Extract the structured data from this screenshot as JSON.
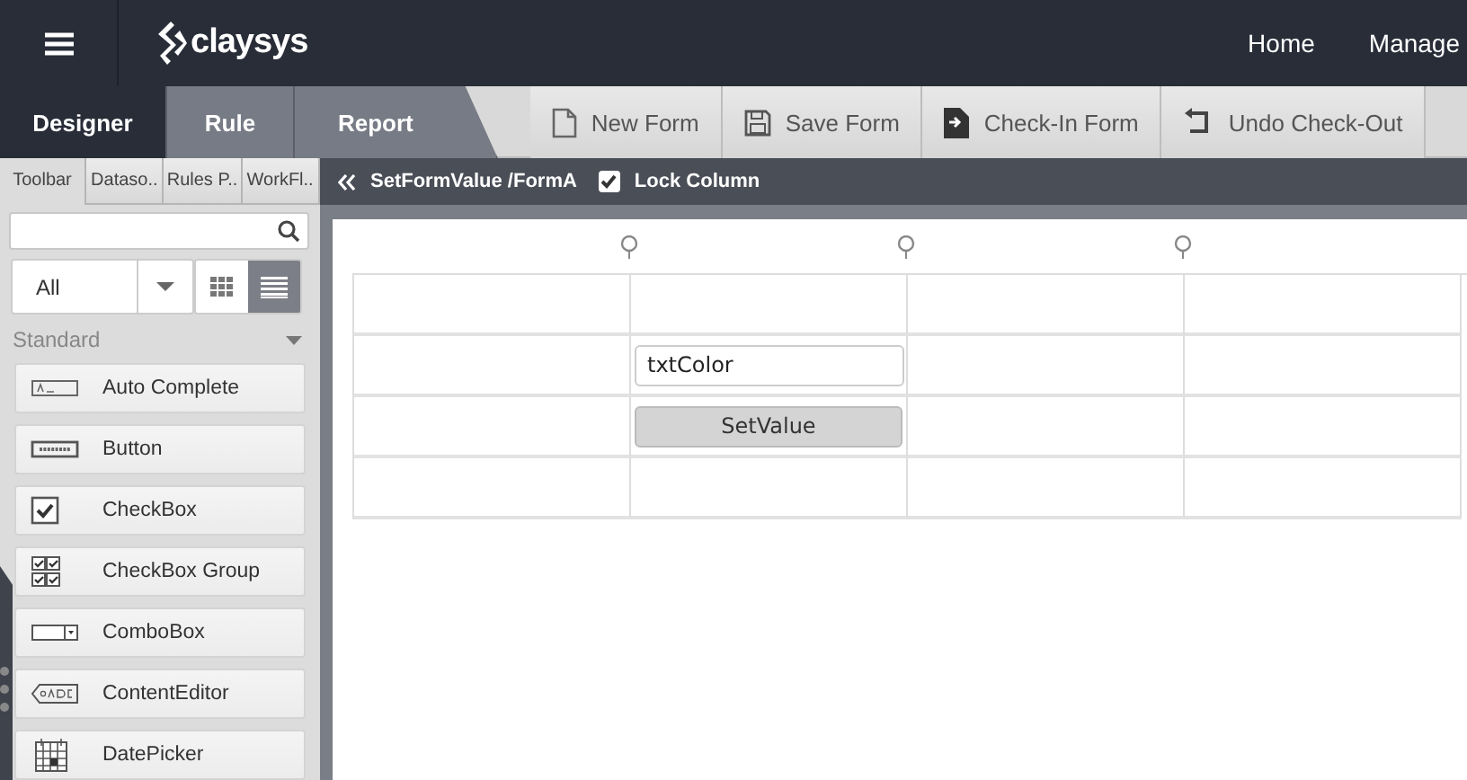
{
  "header": {
    "logo": "claysys",
    "nav": [
      "Home",
      "Manage"
    ]
  },
  "mode_tabs": [
    {
      "label": "Designer",
      "selected": true
    },
    {
      "label": "Rule",
      "selected": false
    },
    {
      "label": "Report",
      "selected": false
    }
  ],
  "toolbar": [
    {
      "kind": "new",
      "label": "New Form"
    },
    {
      "kind": "save",
      "label": "Save Form"
    },
    {
      "kind": "checkin",
      "label": "Check-In Form"
    },
    {
      "kind": "undo",
      "label": "Undo Check-Out"
    }
  ],
  "panel_tabs": [
    {
      "label": "Toolbar",
      "selected": true
    },
    {
      "label": "Dataso..",
      "selected": false
    },
    {
      "label": "Rules P..",
      "selected": false
    },
    {
      "label": "WorkFl..",
      "selected": false
    }
  ],
  "filter": {
    "value": "All"
  },
  "view_toggle": [
    {
      "kind": "grid",
      "selected": false
    },
    {
      "kind": "list",
      "selected": true
    }
  ],
  "section": {
    "title": "Standard",
    "expanded": true
  },
  "items": [
    {
      "kind": "autocomplete",
      "label": "Auto Complete"
    },
    {
      "kind": "button",
      "label": "Button"
    },
    {
      "kind": "checkbox",
      "label": "CheckBox"
    },
    {
      "kind": "checkboxgroup",
      "label": "CheckBox Group"
    },
    {
      "kind": "combobox",
      "label": "ComboBox"
    },
    {
      "kind": "contenteditor",
      "label": "ContentEditor"
    },
    {
      "kind": "datepicker",
      "label": "DatePicker"
    }
  ],
  "breadcrumb": {
    "path": "SetFormValue /FormA",
    "lock_column": {
      "label": "Lock Column",
      "checked": true
    }
  },
  "grid": {
    "rows": [
      {
        "cells": [
          {
            "kind": "empty"
          },
          {
            "kind": "empty"
          },
          {
            "kind": "empty"
          },
          {
            "kind": "empty"
          }
        ]
      },
      {
        "cells": [
          {
            "kind": "empty"
          },
          {
            "kind": "textbox",
            "value": "txtColor"
          },
          {
            "kind": "empty"
          },
          {
            "kind": "empty"
          }
        ]
      },
      {
        "cells": [
          {
            "kind": "empty"
          },
          {
            "kind": "button",
            "label": "SetValue"
          },
          {
            "kind": "empty"
          },
          {
            "kind": "empty"
          }
        ]
      },
      {
        "cells": [
          {
            "kind": "empty"
          },
          {
            "kind": "empty"
          },
          {
            "kind": "empty"
          },
          {
            "kind": "empty"
          }
        ]
      }
    ]
  }
}
